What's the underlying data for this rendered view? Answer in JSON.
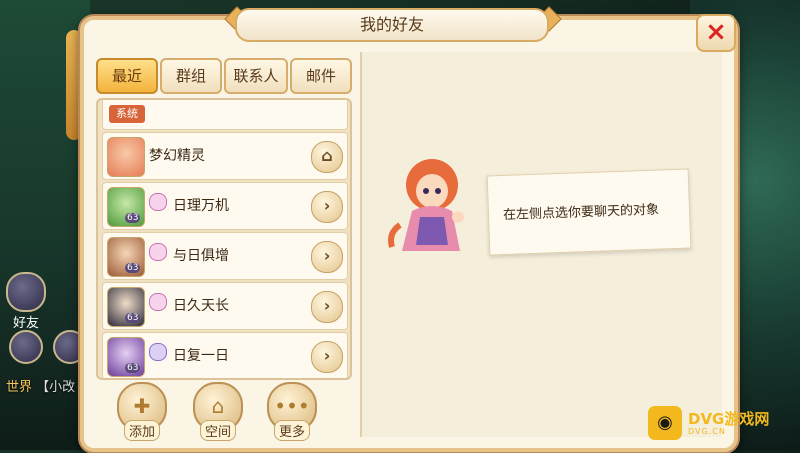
{
  "window": {
    "title": "我的好友",
    "close_icon": "×"
  },
  "tabs": [
    {
      "label": "最近",
      "active": true
    },
    {
      "label": "群组",
      "active": false
    },
    {
      "label": "联系人",
      "active": false
    },
    {
      "label": "邮件",
      "active": false
    }
  ],
  "list": {
    "system_row": {
      "badge": "系统"
    },
    "friends": [
      {
        "name": "梦幻精灵",
        "level": "",
        "action_icon": "home-icon"
      },
      {
        "name": "日理万机",
        "level": "63",
        "action_icon": "chevron-right-icon"
      },
      {
        "name": "与日俱增",
        "level": "63",
        "action_icon": "chevron-right-icon"
      },
      {
        "name": "日久天长",
        "level": "63",
        "action_icon": "chevron-right-icon"
      },
      {
        "name": "日复一日",
        "level": "63",
        "action_icon": "chevron-right-icon"
      }
    ]
  },
  "bottom_buttons": [
    {
      "label": "添加",
      "icon": "add-person-icon"
    },
    {
      "label": "空间",
      "icon": "house-icon"
    },
    {
      "label": "更多",
      "icon": "more-dots-icon"
    }
  ],
  "chat_area": {
    "hint": "在左侧点选你要聊天的对象"
  },
  "background": {
    "side_button_label": "好友",
    "world_chat": {
      "channel": "世界",
      "text": "【小改"
    }
  },
  "watermark": {
    "brand": "DVG游戏网",
    "sub": "DVG.CN"
  },
  "colors": {
    "panel_bg": "#fbf5e5",
    "panel_border": "#e7c38a",
    "active_tab": "#f3b33c",
    "close_x": "#dd2222"
  }
}
